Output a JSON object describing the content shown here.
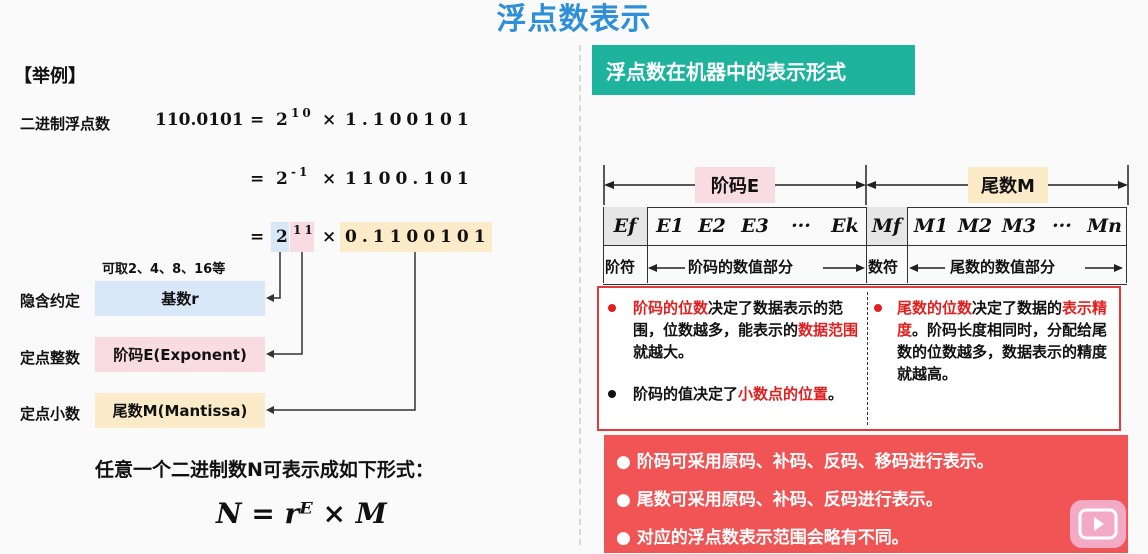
{
  "title": "浮点数表示",
  "left": {
    "example_label": "【举例】",
    "binary_float_label": "二进制浮点数",
    "eq1": {
      "lhs": "110.0101",
      "eq": "=",
      "base": "2",
      "exp": "10",
      "times": "×",
      "mantissa": "1.100101"
    },
    "eq2": {
      "eq": "=",
      "base": "2",
      "exp": "-1",
      "times": "×",
      "mantissa": "1100.101"
    },
    "eq3": {
      "eq": "=",
      "base": "2",
      "exp": "11",
      "times": "×",
      "mantissa": "0.1100101"
    },
    "radix_note": "可取2、4、8、16等",
    "rows": [
      {
        "side": "隐含约定",
        "box": "基数r"
      },
      {
        "side": "定点整数",
        "box": "阶码E(Exponent)"
      },
      {
        "side": "定点小数",
        "box": "尾数M(Mantissa)"
      }
    ],
    "general_statement": "任意一个二进制数N可表示成如下形式：",
    "formula": "N = rᴱ × M"
  },
  "right": {
    "header": "浮点数在机器中的表示形式",
    "exponent_label": "阶码E",
    "mantissa_label": "尾数M",
    "cells": [
      "Ef",
      "E1",
      "E2",
      "E3",
      "···",
      "Ek",
      "Mf",
      "M1",
      "M2",
      "M3",
      "···",
      "Mn"
    ],
    "sub_labels": {
      "exp_sign": "阶符",
      "exp_value": "阶码的数值部分",
      "man_sign": "数符",
      "man_value": "尾数的数值部分"
    },
    "box_left": {
      "b1_red1": "阶码的位数",
      "b1_t1": "决定了数据表示的范围，位数越多，能表示的",
      "b1_red2": "数据范围",
      "b1_t2": "就越大。",
      "b2_t1": "阶码的值决定了",
      "b2_red": "小数点的位置",
      "b2_t2": "。"
    },
    "box_right": {
      "red1": "尾数的位数",
      "t1": "决定了数据的",
      "red2": "表示精度",
      "t2": "。阶码长度相同时，分配给尾数的位数越多，数据表示的精度就越高。"
    },
    "panel": [
      "阶码可采用原码、补码、反码、移码进行表示。",
      "尾数可采用原码、补码、反码进行表示。",
      "对应的浮点数表示范围会略有不同。"
    ]
  }
}
